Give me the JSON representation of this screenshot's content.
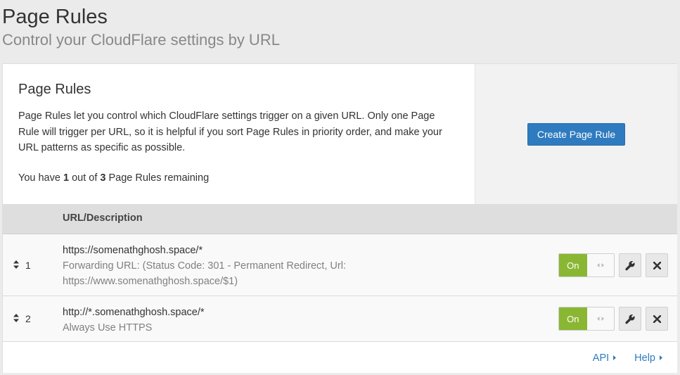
{
  "header": {
    "title": "Page Rules",
    "subtitle": "Control your CloudFlare settings by URL"
  },
  "intro": {
    "title": "Page Rules",
    "description": "Page Rules let you control which CloudFlare settings trigger on a given URL. Only one Page Rule will trigger per URL, so it is helpful if you sort Page Rules in priority order, and make your URL patterns as specific as possible.",
    "remaining_prefix": "You have ",
    "remaining_used": "1",
    "remaining_middle": " out of ",
    "remaining_total": "3",
    "remaining_suffix": " Page Rules remaining"
  },
  "cta": {
    "create_label": "Create Page Rule"
  },
  "table": {
    "column_header": "URL/Description",
    "rows": [
      {
        "priority": "1",
        "url": "https://somenathghosh.space/*",
        "description": "Forwarding URL: (Status Code: 301 - Permanent Redirect, Url: https://www.somenathghosh.space/$1)",
        "toggle_label": "On"
      },
      {
        "priority": "2",
        "url": "http://*.somenathghosh.space/*",
        "description": "Always Use HTTPS",
        "toggle_label": "On"
      }
    ]
  },
  "footer": {
    "api_label": "API",
    "help_label": "Help"
  },
  "icons": {
    "sort": "sort-arrows-icon",
    "edit": "wrench-icon",
    "delete": "close-icon",
    "toggle_handle": "drag-handle-icon",
    "link_caret": "caret-right-icon"
  },
  "colors": {
    "primary": "#2f7bbf",
    "toggle_on": "#8ab733",
    "background": "#ebebeb"
  }
}
